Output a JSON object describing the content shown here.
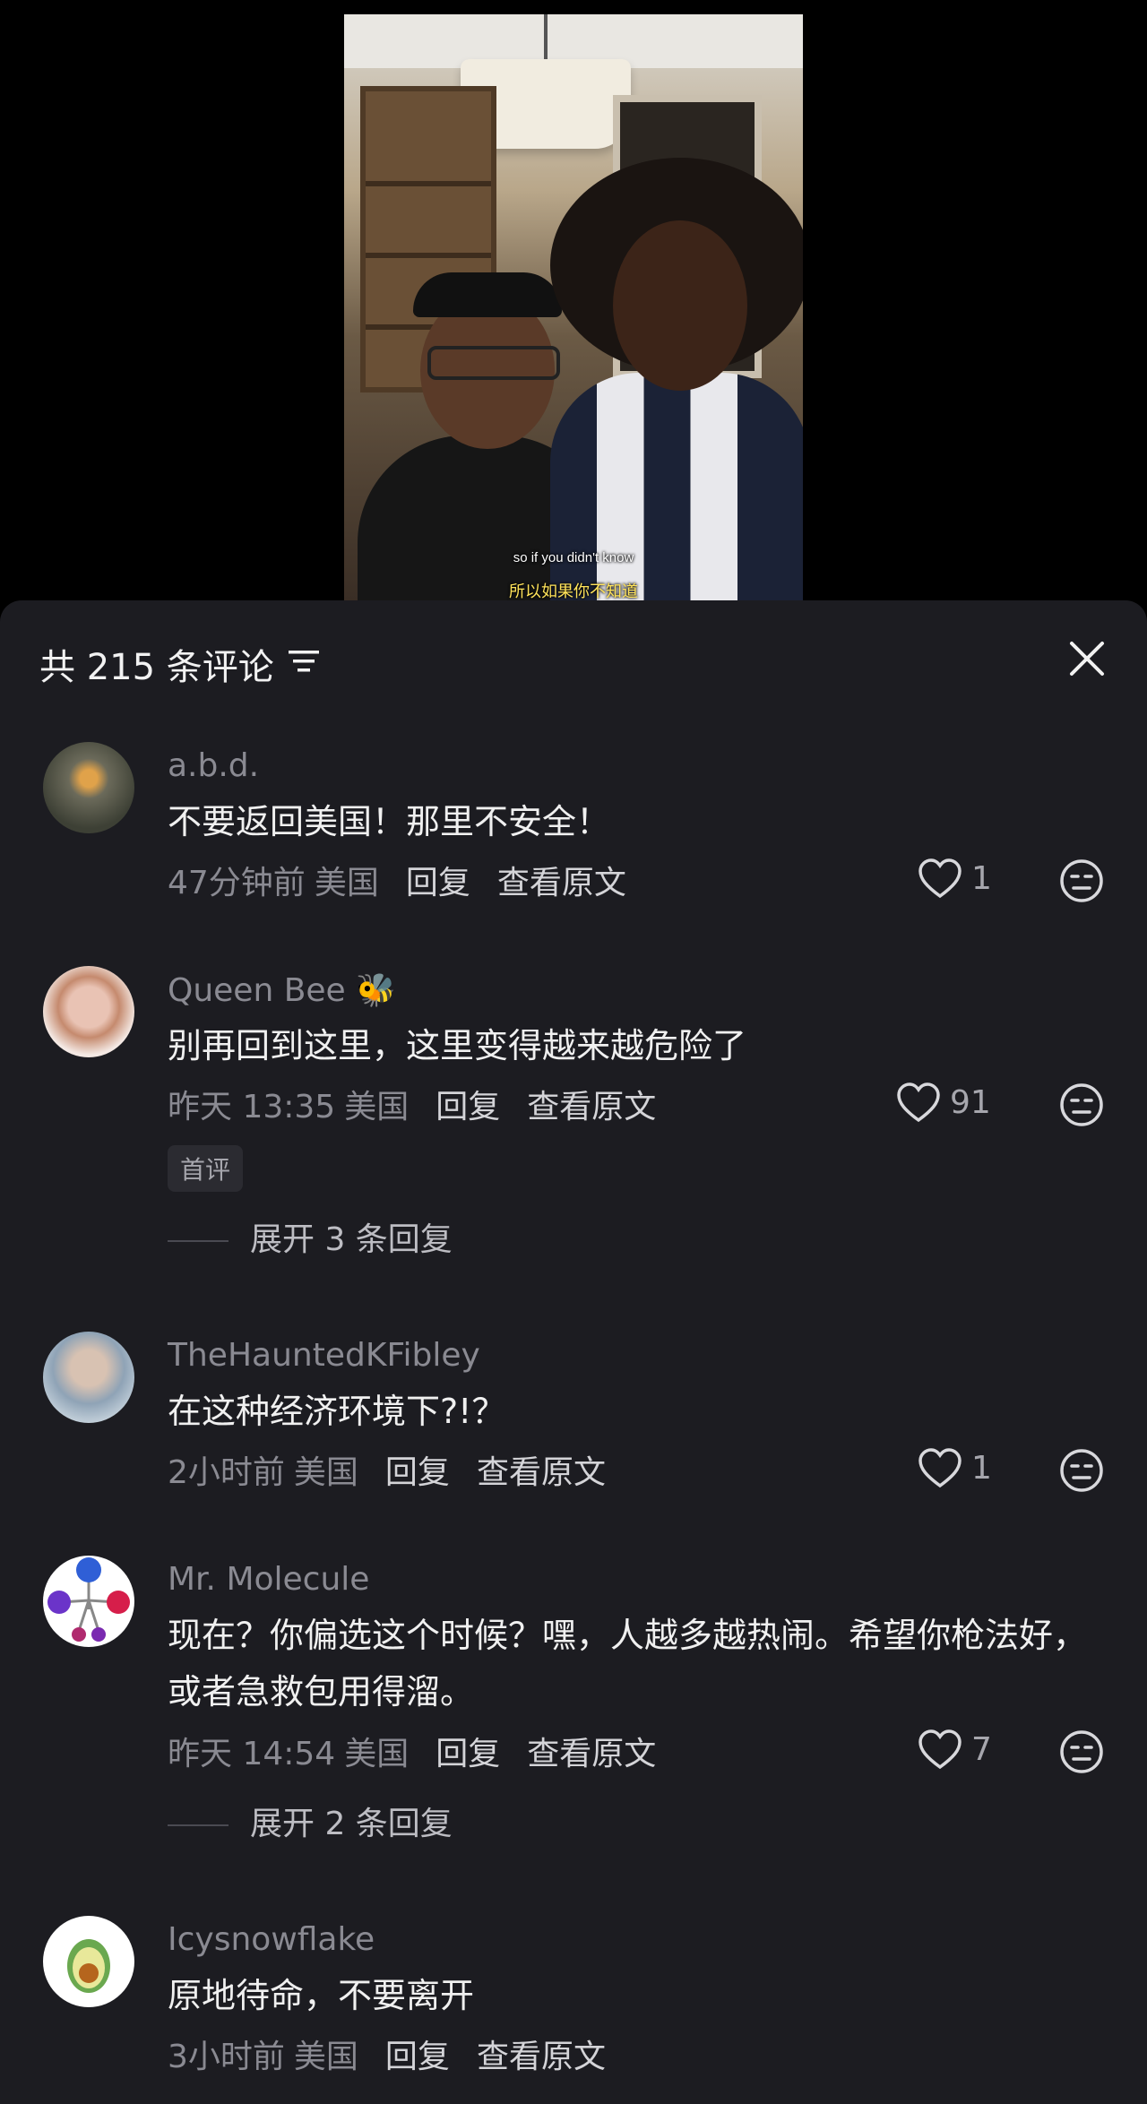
{
  "video": {
    "subtitle_en": "so if you didn't know",
    "subtitle_zh": "所以如果你不知道"
  },
  "comments_panel": {
    "title": "共 215 条评论",
    "comments": [
      {
        "username": "a.b.d.",
        "text": "不要返回美国！那里不安全！",
        "time": "47分钟前",
        "location": "美国",
        "reply_label": "回复",
        "translate_label": "查看原文",
        "likes": "1"
      },
      {
        "username": "Queen Bee 🐝",
        "text": "别再回到这里，这里变得越来越危险了",
        "time": "昨天 13:35",
        "location": "美国",
        "reply_label": "回复",
        "translate_label": "查看原文",
        "likes": "91",
        "badge": "首评",
        "expand": "展开 3 条回复"
      },
      {
        "username": "TheHauntedKFibley",
        "text": "在这种经济环境下?!？",
        "time": "2小时前",
        "location": "美国",
        "reply_label": "回复",
        "translate_label": "查看原文",
        "likes": "1"
      },
      {
        "username": "Mr. Molecule",
        "text": "现在？你偏选这个时候？嘿，人越多越热闹。希望你枪法好，或者急救包用得溜。",
        "time": "昨天 14:54",
        "location": "美国",
        "reply_label": "回复",
        "translate_label": "查看原文",
        "likes": "7",
        "expand": "展开 2 条回复"
      },
      {
        "username": "Icysnowflake",
        "text": "原地待命，不要离开",
        "time": "3小时前",
        "location": "美国",
        "reply_label": "回复",
        "translate_label": "查看原文"
      }
    ]
  },
  "colors": {
    "panel_bg": "#1c1c21",
    "text_primary": "#f0f0f0",
    "text_secondary": "#8a8a92"
  }
}
